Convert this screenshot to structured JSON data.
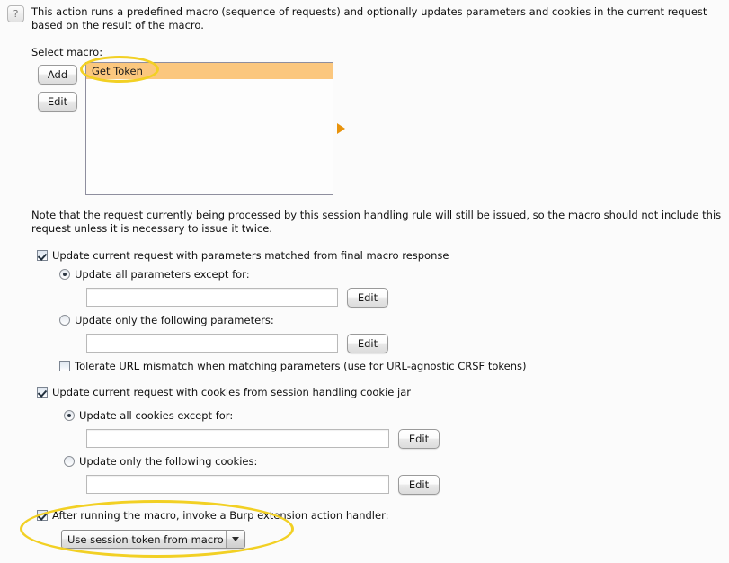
{
  "help": {
    "icon": "question-mark-icon",
    "glyph": "?"
  },
  "description": "This action runs a predefined macro (sequence of requests) and optionally updates parameters and cookies in the current request based on the result of the macro.",
  "select_macro_label": "Select macro:",
  "macro_panel": {
    "add_button": "Add",
    "edit_button": "Edit",
    "list_items": [
      "Get Token"
    ],
    "selected_item": "Get Token",
    "play_arrow_icon": "play-arrow-icon"
  },
  "note": "Note that the request currently being processed by this session handling rule will still be issued, so the macro should not include this request unless it is necessary to issue it twice.",
  "parameters_section": {
    "checkbox_label": "Update current request with parameters matched from final macro response",
    "checkbox_checked": true,
    "radio_all_except_label": "Update all parameters except for:",
    "radio_all_except_selected": true,
    "input_all_except_value": "",
    "edit_all_except_button": "Edit",
    "radio_only_following_label": "Update only the following parameters:",
    "radio_only_following_selected": false,
    "input_only_following_value": "",
    "edit_only_following_button": "Edit",
    "tolerate_checkbox_label": "Tolerate URL mismatch when matching parameters (use for URL-agnostic CRSF tokens)",
    "tolerate_checkbox_checked": false
  },
  "cookies_section": {
    "checkbox_label": "Update current request with cookies from session handling cookie jar",
    "checkbox_checked": true,
    "radio_all_except_label": "Update all cookies except for:",
    "radio_all_except_selected": true,
    "input_all_except_value": "",
    "edit_all_except_button": "Edit",
    "radio_only_following_label": "Update only the following cookies:",
    "radio_only_following_selected": false,
    "input_only_following_value": "",
    "edit_only_following_button": "Edit"
  },
  "extension_section": {
    "checkbox_label": "After running the macro, invoke a Burp extension action handler:",
    "checkbox_checked": true,
    "combo_selected": "Use session token from macro",
    "combo_arrow_icon": "chevron-down-icon"
  },
  "colors": {
    "selection_orange": "#fbc77e",
    "arrow_orange": "#e8930c",
    "annotation_yellow": "#f2d024",
    "background": "#fbfbfb"
  }
}
